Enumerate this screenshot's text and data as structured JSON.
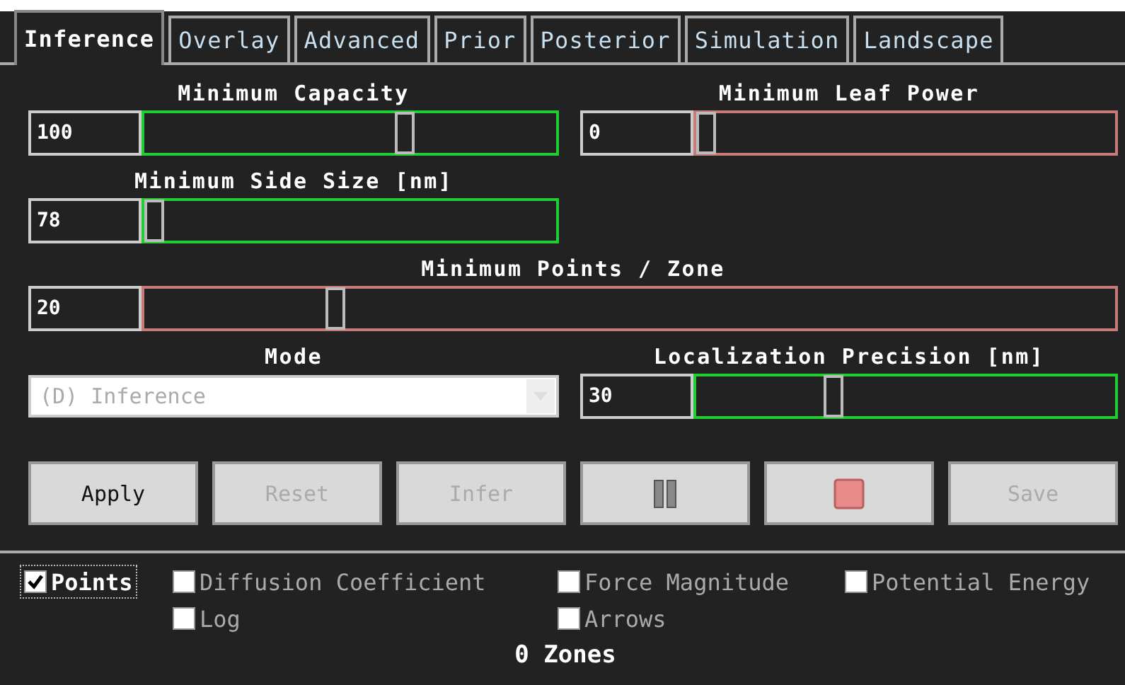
{
  "tabs": [
    {
      "label": "Inference",
      "selected": true
    },
    {
      "label": "Overlay",
      "selected": false
    },
    {
      "label": "Advanced",
      "selected": false
    },
    {
      "label": "Prior",
      "selected": false
    },
    {
      "label": "Posterior",
      "selected": false
    },
    {
      "label": "Simulation",
      "selected": false
    },
    {
      "label": "Landscape",
      "selected": false
    }
  ],
  "rows": [
    {
      "items": [
        {
          "kind": "slider",
          "label": "Minimum Capacity",
          "value": "100",
          "level": 0.64,
          "valid": true
        },
        {
          "kind": "slider",
          "label": "Minimum Leaf Power",
          "value": "0",
          "level": 0,
          "valid": false
        }
      ]
    },
    {
      "items": [
        {
          "kind": "slider",
          "label": "Minimum Side Size [nm]",
          "value": "78",
          "level": 0,
          "valid": true
        }
      ]
    },
    {
      "items": [
        {
          "kind": "wide-slider",
          "label": "Minimum Points / Zone",
          "value": "20",
          "level": 0.19,
          "valid": false
        }
      ]
    },
    {
      "items": [
        {
          "kind": "dropdown",
          "label": "Mode",
          "value": "(D) Inference",
          "disabled": true
        },
        {
          "kind": "slider",
          "label": "Localization Precision [nm]",
          "value": "30",
          "level": 0.32,
          "valid": true
        }
      ]
    }
  ],
  "buttons": [
    {
      "kind": "text",
      "label": "Apply",
      "disabled": false
    },
    {
      "kind": "text",
      "label": "Reset",
      "disabled": true
    },
    {
      "kind": "text",
      "label": "Infer",
      "disabled": true
    },
    {
      "kind": "pause",
      "disabled": true
    },
    {
      "kind": "stop",
      "disabled": false
    },
    {
      "kind": "text",
      "label": "Save",
      "disabled": true
    }
  ],
  "option_rows": [
    {
      "items": [
        {
          "label": "Points",
          "checked": true,
          "focused": true,
          "disabled": false
        },
        {
          "label": "Diffusion Coefficient",
          "checked": false,
          "focused": false,
          "disabled": true
        },
        {
          "label": "Force Magnitude",
          "checked": false,
          "focused": false,
          "disabled": true
        },
        {
          "label": "Potential Energy",
          "checked": false,
          "focused": false,
          "disabled": true
        }
      ]
    },
    {
      "items": [
        {
          "label": "Log",
          "checked": false,
          "focused": false,
          "disabled": true
        },
        {
          "label": "Arrows",
          "checked": false,
          "focused": false,
          "disabled": true
        }
      ]
    }
  ],
  "status": "0 Zones"
}
